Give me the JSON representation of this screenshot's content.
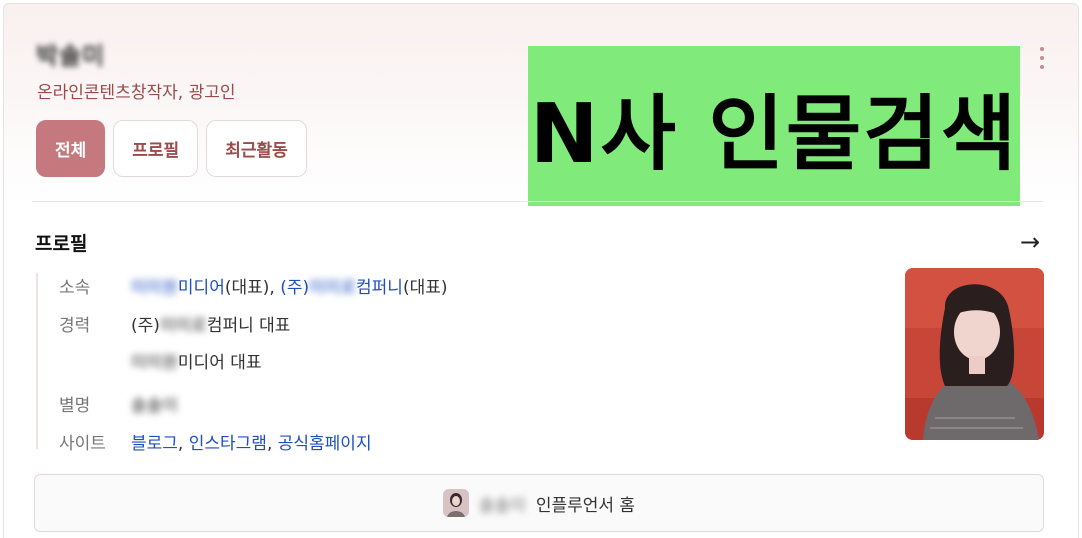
{
  "profile": {
    "name": "박솔미",
    "occupation": "온라인콘텐츠창작자, 광고인"
  },
  "tabs": [
    {
      "label": "전체",
      "active": true
    },
    {
      "label": "프로필",
      "active": false
    },
    {
      "label": "최근활동",
      "active": false
    }
  ],
  "overlay": {
    "text": "N사 인물검색",
    "color": "#80ea7a"
  },
  "section": {
    "title": "프로필"
  },
  "details": {
    "affiliation": {
      "label": "소속",
      "company1_name": "미미원",
      "company1_suffix": "미디어",
      "company1_role": "(대표)",
      "company2_prefix": "(주)",
      "company2_name": "미미로",
      "company2_suffix": "컴퍼니",
      "company2_role": "(대표)"
    },
    "career": {
      "label": "경력",
      "line1_prefix": "(주)",
      "line1_name": "미미로",
      "line1_suffix": "컴퍼니 대표",
      "line2_name": "미미원",
      "line2_suffix": "미디어 대표"
    },
    "alias": {
      "label": "별명",
      "value": "솔솔이"
    },
    "sites": {
      "label": "사이트",
      "blog": "블로그",
      "instagram": "인스타그램",
      "homepage": "공식홈페이지"
    }
  },
  "influencer": {
    "name": "솔솔이",
    "label": "인플루언서 홈"
  },
  "icons": {
    "more": "more-vertical-icon",
    "arrow": "arrow-right-icon"
  },
  "colors": {
    "accent": "#c5797e",
    "occupation_text": "#9a4b4b",
    "link": "#1f4ec2"
  }
}
